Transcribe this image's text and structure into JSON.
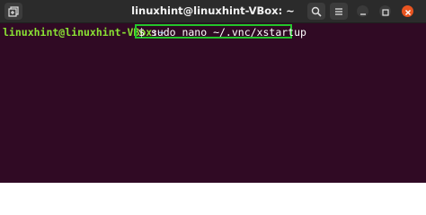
{
  "window": {
    "title": "linuxhint@linuxhint-VBox: ~"
  },
  "titlebar": {
    "new_tab_icon": "new-tab-icon",
    "search_icon": "search-icon",
    "menu_icon": "hamburger-menu-icon",
    "minimize_icon": "minimize-icon",
    "maximize_icon": "maximize-icon",
    "close_icon": "close-icon"
  },
  "terminal": {
    "prompt_user": "linuxhint@linuxhint-VBox",
    "prompt_colon": ":",
    "prompt_path": "~",
    "command": "$ sudo nano ~/.vnc/xstartup"
  },
  "colors": {
    "terminal_bg": "#300a24",
    "titlebar_bg": "#2b2b2b",
    "prompt_user": "#8ae234",
    "prompt_path": "#729fcf",
    "highlight_box": "#23c52b",
    "close_button": "#e95420"
  }
}
